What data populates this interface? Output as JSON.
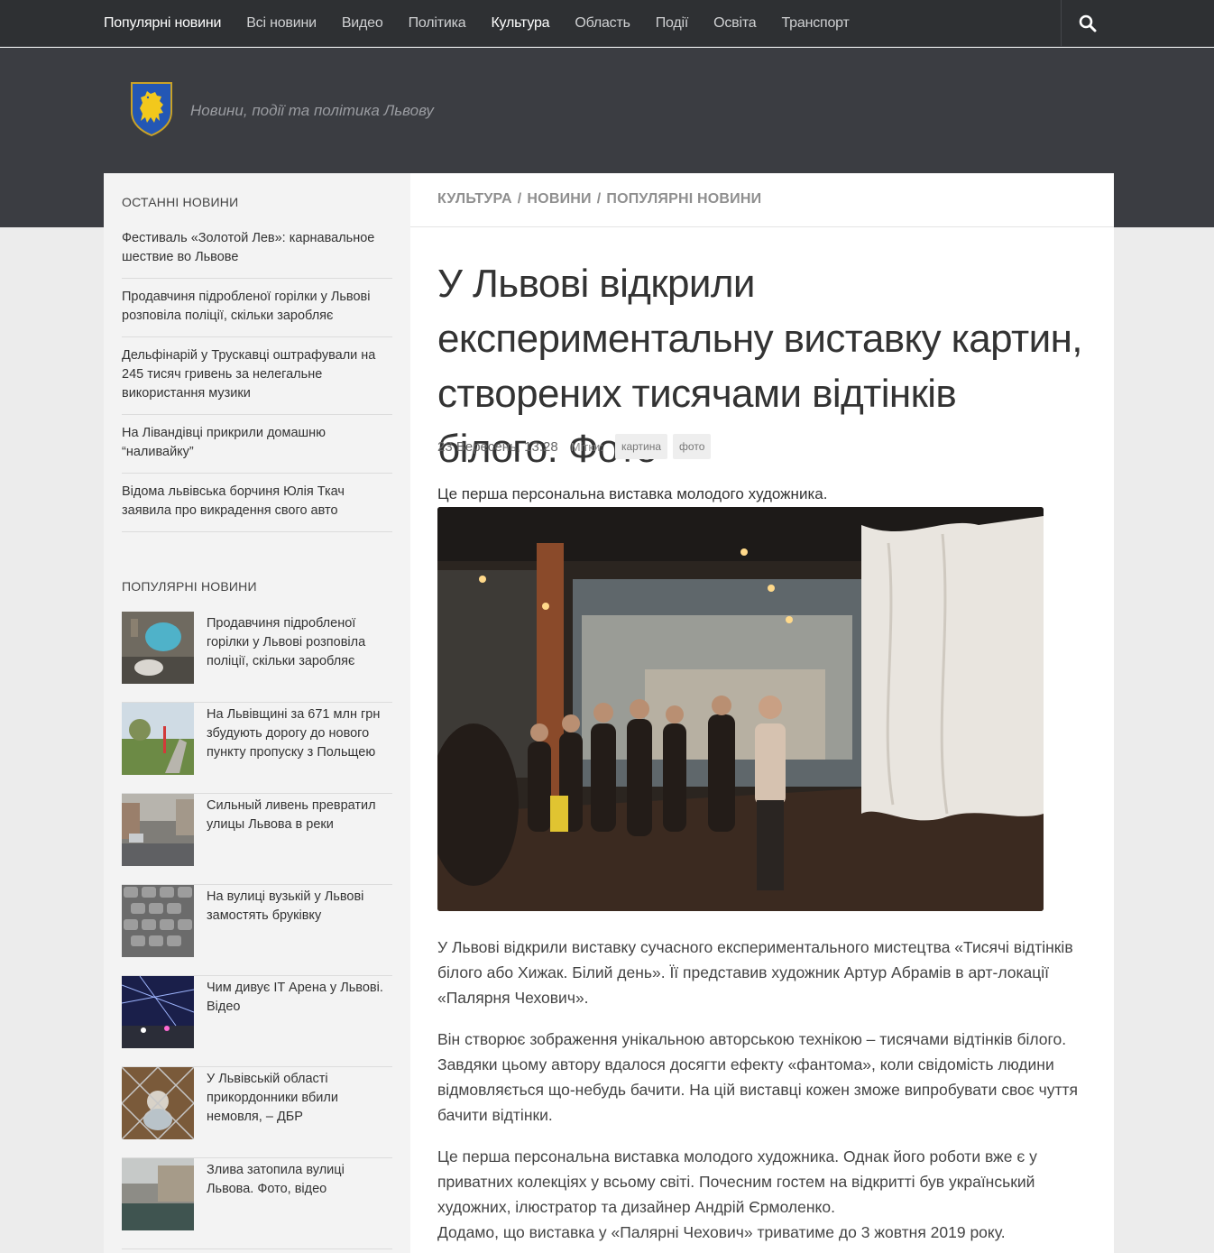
{
  "nav": {
    "items": [
      {
        "label": "Популярні новини",
        "active": true
      },
      {
        "label": "Всі новини",
        "active": false
      },
      {
        "label": "Видео",
        "active": false
      },
      {
        "label": "Політика",
        "active": false
      },
      {
        "label": "Культура",
        "active": true
      },
      {
        "label": "Область",
        "active": false
      },
      {
        "label": "Події",
        "active": false
      },
      {
        "label": "Освіта",
        "active": false
      },
      {
        "label": "Транспорт",
        "active": false
      }
    ],
    "search_icon": "search-icon"
  },
  "header": {
    "logo_icon": "lion-coat-of-arms-icon",
    "tagline": "Новини, події та політика Львову"
  },
  "sidebar": {
    "latest_title": "Останні новини",
    "latest": [
      "Фестиваль «Золотой Лев»: карнавальное шествие во Львове",
      "Продавчиня підробленої горілки у Львові розповіла поліції, скільки заробляє",
      "Дельфінарій у Трускавці оштрафували на 245 тисяч гривень за нелегальне використання музики",
      "На Лівандівці прикрили домашню “наливайку”",
      "Відома львівська борчиня Юлія Ткач заявила про викрадення свого авто"
    ],
    "popular_title": "Популярні новини",
    "popular": [
      "Продавчиня підробленої горілки у Львові розповіла поліції, скільки заробляє",
      "На Львівщині за 671 млн грн збудують дорогу до нового пункту пропуску з Польщею",
      "Сильный ливень превратил улицы Львова в реки",
      "На вулиці вузькій у Львові замостять бруківку",
      "Чим дивує IT Арена у Львові. Відео",
      "У Львівській області прикордонники вбили немовля, – ДБР",
      "Злива затопила вулиці Львова. Фото, відео"
    ]
  },
  "article": {
    "breadcrumbs": [
      "Культура",
      "Новини",
      "Популярні новини"
    ],
    "title": "У Львові відкрили експериментальну виставку картин, створених тисячами відтінків білого. Фото",
    "date": "23 Вересень, 13:28",
    "tags_label": "Мітки:",
    "tags": [
      "картина",
      "фото"
    ],
    "lead": "Це перша персональна виставка молодого художника.",
    "paragraphs": [
      "У Львові відкрили виставку сучасного експериментального мистецтва «Тисячі відтінків білого або Хижак. Білий день». Її представив художник Артур Абрамів в арт-локації «Палярня Чехович».",
      "Він створює зображення унікальною авторською технікою – тисячами відтінків білого. Завдяки цьому автору вдалося досягти ефекту «фантома», коли свідомість людини відмовляється що-небудь бачити. На цій виставці кожен зможе випробувати своє чуття бачити відтінки.",
      "Це перша персональна виставка молодого художника. Однак його роботи вже є у приватних колекціях у всьому світі. Почесним гостем на відкритті був український художних, ілюстратор та дизайнер Андрій Єрмоленко.",
      "Додамо, що виставка у «Палярні Чехович» триватиме до 3 жовтня 2019 року."
    ]
  }
}
